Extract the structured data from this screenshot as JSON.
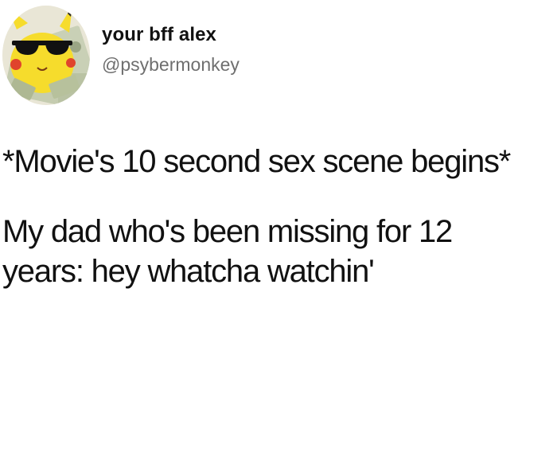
{
  "tweet": {
    "author": {
      "display_name": "your bff alex",
      "handle": "@psybermonkey",
      "avatar_icon": "pikachu-with-sunglasses-and-cash-avatar"
    },
    "paragraphs": [
      "*Movie's 10 second sex scene begins*",
      "My dad who's been missing for 12\nyears: hey whatcha watchin'"
    ]
  },
  "colors": {
    "background": "#ffffff",
    "text": "#111111",
    "handle": "#6f6f6f"
  }
}
